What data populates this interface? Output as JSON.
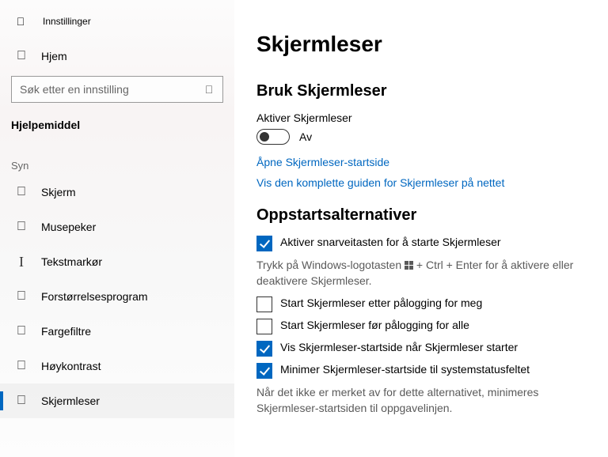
{
  "app": {
    "title": "Innstillinger"
  },
  "sidebar": {
    "home": "Hjem",
    "searchPlaceholder": "Søk etter en innstilling",
    "group": "Hjelpemiddel",
    "subgroup": "Syn",
    "items": [
      {
        "label": "Skjerm"
      },
      {
        "label": "Musepeker"
      },
      {
        "label": "Tekstmarkør"
      },
      {
        "label": "Forstørrelsesprogram"
      },
      {
        "label": "Fargefiltre"
      },
      {
        "label": "Høykontrast"
      },
      {
        "label": "Skjermleser"
      }
    ]
  },
  "main": {
    "title": "Skjermleser",
    "useSection": "Bruk Skjermleser",
    "activateLabel": "Aktiver Skjermleser",
    "toggleState": "Av",
    "link1": "Åpne Skjermleser-startside",
    "link2": "Vis den komplette guiden for Skjermleser på nettet",
    "startupSection": "Oppstartsalternativer",
    "cb1": "Aktiver snarveitasten for å starte Skjermleser",
    "hint1a": "Trykk på Windows-logotasten ",
    "hint1b": " + Ctrl + Enter for å aktivere eller deaktivere Skjermleser.",
    "cb2": "Start Skjermleser etter pålogging for meg",
    "cb3": "Start Skjermleser før pålogging for alle",
    "cb4": "Vis Skjermleser-startside når Skjermleser starter",
    "cb5": "Minimer Skjermleser-startside til systemstatusfeltet",
    "hint5": "Når det ikke er merket av for dette alternativet, minimeres Skjermleser-startsiden til oppgavelinjen."
  }
}
